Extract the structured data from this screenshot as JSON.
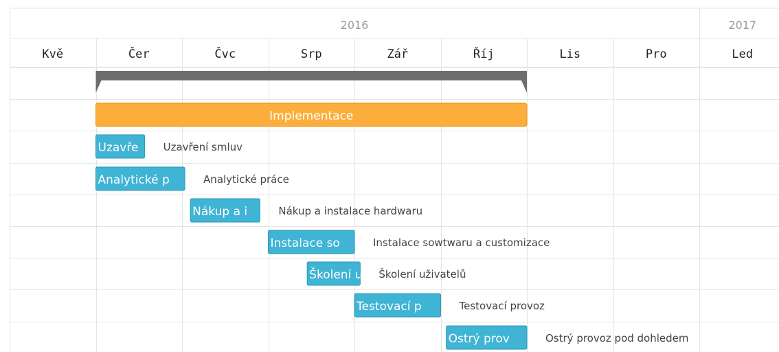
{
  "chart_data": {
    "type": "gantt",
    "years": [
      {
        "label": "2016",
        "start": "2016-05-01",
        "end": "2017-01-01"
      },
      {
        "label": "2017",
        "start": "2017-01-01",
        "end": "2017-02-01"
      }
    ],
    "months": [
      {
        "label": "Kvě",
        "start": "2016-05-01",
        "end": "2016-06-01"
      },
      {
        "label": "Čer",
        "start": "2016-06-01",
        "end": "2016-07-01"
      },
      {
        "label": "Čvc",
        "start": "2016-07-01",
        "end": "2016-08-01"
      },
      {
        "label": "Srp",
        "start": "2016-08-01",
        "end": "2016-09-01"
      },
      {
        "label": "Zář",
        "start": "2016-09-01",
        "end": "2016-10-01"
      },
      {
        "label": "Říj",
        "start": "2016-10-01",
        "end": "2016-11-01"
      },
      {
        "label": "Lis",
        "start": "2016-11-01",
        "end": "2016-12-01"
      },
      {
        "label": "Pro",
        "start": "2016-12-01",
        "end": "2017-01-01"
      },
      {
        "label": "Led",
        "start": "2017-01-01",
        "end": "2017-02-01"
      }
    ],
    "summary_bracket": {
      "start": "2016-06-01",
      "end": "2016-11-01"
    },
    "summary": {
      "name": "Implementace",
      "start": "2016-06-01",
      "end": "2016-11-01"
    },
    "tasks": [
      {
        "name": "Uzavření smluv",
        "bar_text": "Uzavře",
        "start": "2016-06-01",
        "end": "2016-06-18"
      },
      {
        "name": "Analytické práce",
        "bar_text": "Analytické p",
        "start": "2016-06-01",
        "end": "2016-07-02"
      },
      {
        "name": "Nákup a instalace hardwaru",
        "bar_text": "Nákup a i",
        "start": "2016-07-04",
        "end": "2016-07-29"
      },
      {
        "name": "Instalace sowtwaru a customizace",
        "bar_text": "Instalace so",
        "start": "2016-08-01",
        "end": "2016-09-01"
      },
      {
        "name": "Školení uživatelů",
        "bar_text": "Školení u",
        "start": "2016-08-15",
        "end": "2016-09-03"
      },
      {
        "name": "Testovací provoz",
        "bar_text": "Testovací p",
        "start": "2016-09-01",
        "end": "2016-10-01"
      },
      {
        "name": "Ostrý provoz pod dohledem",
        "bar_text": "Ostrý prov",
        "start": "2016-10-03",
        "end": "2016-11-01"
      }
    ],
    "colors": {
      "task": "#3fb4d4",
      "task_border": "#2a9ab9",
      "summary": "#fbae3c",
      "summary_border": "#e8961a",
      "bracket": "#6d6d6d",
      "grid": "#e4e4e4"
    }
  }
}
